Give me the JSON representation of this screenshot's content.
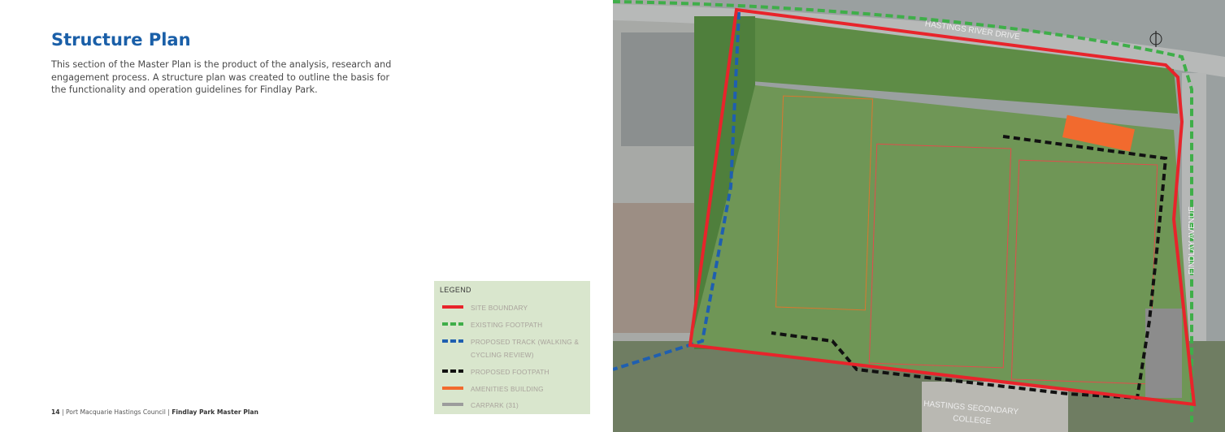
{
  "page": {
    "title": "Structure Plan",
    "intro": "This section of the Master Plan is the product of the analysis, research and engagement process. A structure plan was created to outline the basis for the functionality and operation guidelines for Findlay Park."
  },
  "legend": {
    "title": "LEGEND",
    "items": [
      {
        "label": "SITE BOUNDARY",
        "color": "#e8242b",
        "style": "solid"
      },
      {
        "label": "EXISTING FOOTPATH",
        "color": "#3fae49",
        "style": "dashed"
      },
      {
        "label": "PROPOSED TRACK (WALKING & CYCLING REVIEW)",
        "color": "#1f5fb0",
        "style": "dashed"
      },
      {
        "label": "PROPOSED FOOTPATH",
        "color": "#111111",
        "style": "dashed"
      },
      {
        "label": "AMENITIES BUILDING",
        "color": "#f26a2e",
        "style": "solid"
      },
      {
        "label": "CARPARK (31)",
        "color": "#9c9c9c",
        "style": "solid"
      }
    ]
  },
  "map": {
    "street_labels": [
      "HASTINGS RIVER DRIVE",
      "FINDLAY AVENUE",
      "HASTINGS SECONDARY",
      "COLLEGE"
    ]
  },
  "footer": {
    "page_number": "14",
    "council": "| Port Macquarie Hastings Council",
    "separator": "|",
    "doc_title": "Findlay Park Master Plan"
  }
}
